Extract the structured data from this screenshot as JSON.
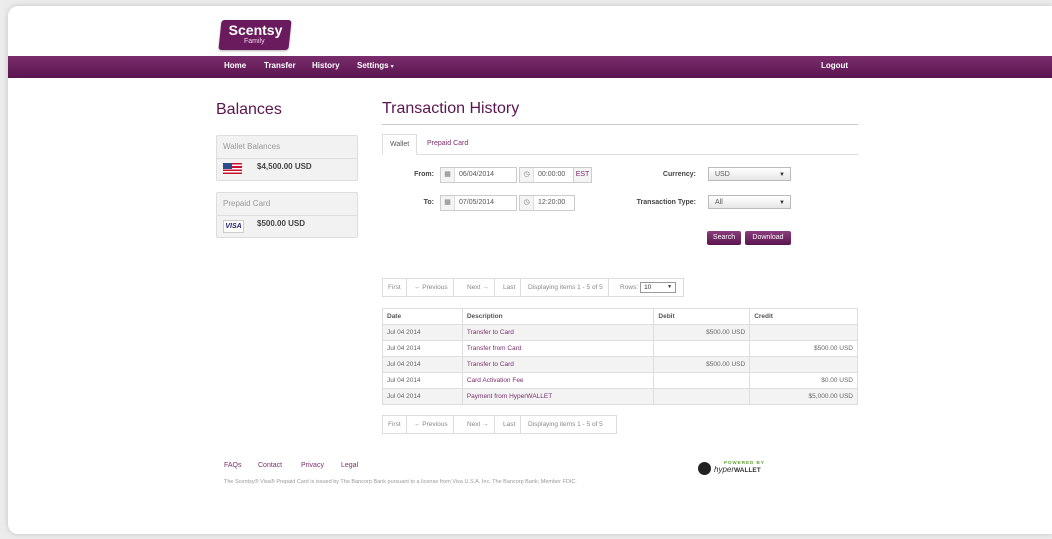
{
  "logo": {
    "name": "Scentsy",
    "sub": "Family"
  },
  "nav": {
    "items": [
      "Home",
      "Transfer",
      "History",
      "Settings"
    ],
    "caret": "▾",
    "logout": "Logout"
  },
  "balances": {
    "title": "Balances",
    "wallet": {
      "label": "Wallet Balances",
      "amount": "$4,500.00 USD",
      "icon": "us-flag-icon"
    },
    "prepaid": {
      "label": "Prepaid Card",
      "amount": "$500.00 USD",
      "icon_text": "VISA"
    }
  },
  "history": {
    "title": "Transaction History",
    "tabs": [
      "Wallet",
      "Prepaid Card"
    ],
    "from_label": "From:",
    "to_label": "To:",
    "from_date": "06/04/2014",
    "from_time": "00:00:00",
    "timezone": "EST",
    "to_date": "07/05/2014",
    "to_time": "12:20:00",
    "currency_label": "Currency:",
    "currency_value": "USD",
    "type_label": "Transaction Type:",
    "type_value": "All",
    "search_label": "Search",
    "download_label": "Download"
  },
  "pager": {
    "first": "First",
    "previous": "← Previous",
    "next": "Next →",
    "last": "Last",
    "info": "Displaying items 1 - 5 of 5",
    "rows_label": "Rows:",
    "rows_value": "10"
  },
  "table": {
    "headers": [
      "Date",
      "Description",
      "Debit",
      "Credit"
    ],
    "rows": [
      [
        "Jul 04 2014",
        "Transfer to Card",
        "$500.00 USD",
        ""
      ],
      [
        "Jul 04 2014",
        "Transfer from Card",
        "",
        "$500.00 USD"
      ],
      [
        "Jul 04 2014",
        "Transfer to Card",
        "$500.00 USD",
        ""
      ],
      [
        "Jul 04 2014",
        "Card Activation Fee",
        "",
        "$0.00 USD"
      ],
      [
        "Jul 04 2014",
        "Payment from HyperWALLET",
        "",
        "$5,000.00 USD"
      ]
    ]
  },
  "footer": {
    "links": [
      "FAQs",
      "Contact",
      "Privacy",
      "Legal"
    ],
    "disclaimer": "The Scentsy® Visa® Prepaid Card is issued by The Bancorp Bank pursuant to a license from Visa U.S.A. Inc. The Bancorp Bank; Member FDIC.",
    "powered": "POWERED BY",
    "brand_a": "hyper",
    "brand_b": "WALLET"
  },
  "colors": {
    "brand": "#5a1550",
    "accent": "#7a2d6c"
  }
}
